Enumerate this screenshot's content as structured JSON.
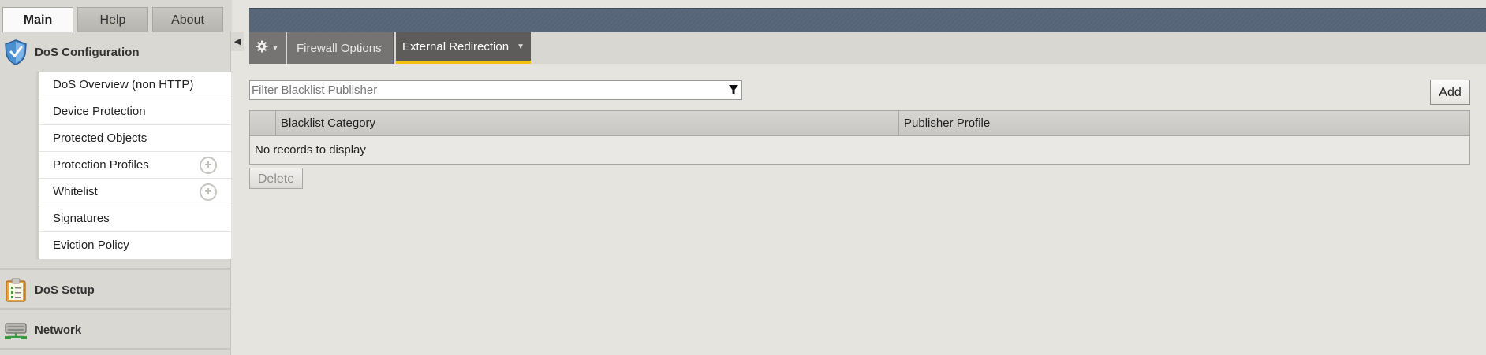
{
  "top_tabs": [
    {
      "label": "Main",
      "active": true
    },
    {
      "label": "Help",
      "active": false
    },
    {
      "label": "About",
      "active": false
    }
  ],
  "sidebar": {
    "sections": [
      {
        "label": "DoS Configuration",
        "icon": "shield-icon",
        "expanded": true
      },
      {
        "label": "DoS Setup",
        "icon": "clipboard-icon",
        "expanded": false
      },
      {
        "label": "Network",
        "icon": "network-icon",
        "expanded": false
      }
    ],
    "items": [
      {
        "label": "DoS Overview (non HTTP)",
        "has_add": false
      },
      {
        "label": "Device Protection",
        "has_add": false
      },
      {
        "label": "Protected Objects",
        "has_add": false
      },
      {
        "label": "Protection Profiles",
        "has_add": true
      },
      {
        "label": "Whitelist",
        "has_add": true
      },
      {
        "label": "Signatures",
        "has_add": false
      },
      {
        "label": "Eviction Policy",
        "has_add": false
      }
    ]
  },
  "sub_tabs": [
    {
      "label": "Firewall Options",
      "active": false
    },
    {
      "label": "External Redirection",
      "active": true
    }
  ],
  "filter": {
    "placeholder": "Filter Blacklist Publisher",
    "value": ""
  },
  "toolbar": {
    "add_label": "Add",
    "delete_label": "Delete"
  },
  "table": {
    "columns": [
      "Blacklist Category",
      "Publisher Profile"
    ],
    "empty_text": "No records to display"
  },
  "colors": {
    "accent": "#f2c010",
    "header": "#56647a"
  }
}
